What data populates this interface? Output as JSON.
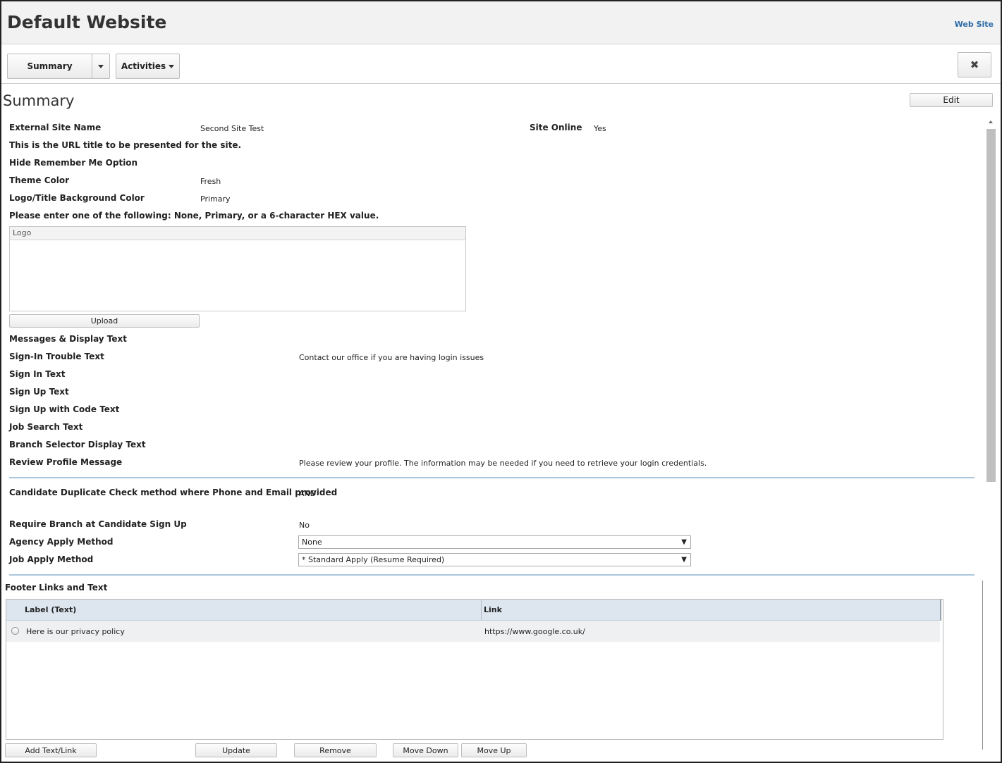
{
  "header": {
    "title": "Default Website",
    "breadcrumb": "Web Site"
  },
  "toolbar": {
    "summary_label": "Summary",
    "activities_label": "Activities",
    "close_symbol": "✖"
  },
  "summary": {
    "title": "Summary",
    "edit_label": "Edit",
    "fields": {
      "external_site_name": {
        "label": "External Site Name",
        "value": "Second Site Test"
      },
      "site_online": {
        "label": "Site Online",
        "value": "Yes"
      },
      "url_note": "This is the URL title to be presented for the site.",
      "hide_remember_me": {
        "label": "Hide Remember Me Option"
      },
      "theme_color": {
        "label": "Theme Color",
        "value": "Fresh"
      },
      "logo_bg_color": {
        "label": "Logo/Title Background Color",
        "value": "Primary"
      },
      "hex_note": "Please enter one of the following: None, Primary, or a 6-character HEX value.",
      "logo_header": "Logo",
      "upload_label": "Upload",
      "messages_heading": "Messages & Display Text",
      "sign_in_trouble": {
        "label": "Sign-In Trouble Text",
        "value": "Contact our office if you are having login issues"
      },
      "sign_in_text": {
        "label": "Sign In Text"
      },
      "sign_up_text": {
        "label": "Sign Up Text"
      },
      "sign_up_code_text": {
        "label": "Sign Up with Code Text"
      },
      "job_search_text": {
        "label": "Job Search Text"
      },
      "branch_selector_text": {
        "label": "Branch Selector Display Text"
      },
      "review_profile": {
        "label": "Review Profile Message",
        "value": "Please review your profile.  The information may be needed if you need to retrieve your login credentials."
      },
      "dup_check": {
        "label": "Candidate Duplicate Check method where Phone and Email provided",
        "value": "AND"
      },
      "require_branch": {
        "label": "Require Branch at Candidate Sign Up",
        "value": "No"
      },
      "agency_apply": {
        "label": "Agency Apply Method",
        "value": "None"
      },
      "job_apply": {
        "label": "Job Apply Method",
        "value": "* Standard Apply (Resume Required)"
      }
    }
  },
  "footer_links": {
    "heading": "Footer Links and Text",
    "columns": [
      "Label (Text)",
      "Link"
    ],
    "rows": [
      {
        "label": "Here is our privacy policy",
        "link": "https://www.google.co.uk/"
      }
    ],
    "buttons": {
      "add": "Add Text/Link",
      "update": "Update",
      "remove": "Remove",
      "move_down": "Move Down",
      "move_up": "Move Up"
    }
  },
  "colors": {
    "link": "#2e6ca6",
    "header_bg": "#f2f2f2",
    "grid_header_bg": "#dde6ef",
    "rule": "#aac6dc"
  }
}
